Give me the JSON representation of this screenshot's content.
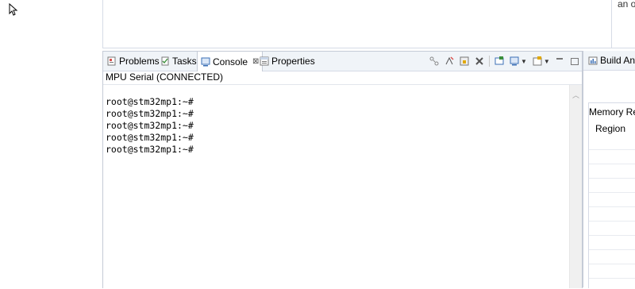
{
  "top_right_text": "an o",
  "tabs": [
    {
      "label": "Problems",
      "icon": "problems-icon"
    },
    {
      "label": "Tasks",
      "icon": "tasks-icon"
    },
    {
      "label": "Console",
      "icon": "console-icon",
      "active": true
    },
    {
      "label": "Properties",
      "icon": "properties-icon"
    }
  ],
  "console": {
    "title": "MPU Serial (CONNECTED)",
    "lines": [
      "root@stm32mp1:~#",
      "root@stm32mp1:~#",
      "root@stm32mp1:~#",
      "root@stm32mp1:~#",
      "root@stm32mp1:~#"
    ]
  },
  "right_panel": {
    "tab_label": "Build Ana",
    "header": "Memory Re",
    "column": "Region"
  },
  "colors": {
    "accent": "#3b6fb6",
    "tab_bar": "#f0f4f8",
    "border": "#c5cbd6"
  }
}
